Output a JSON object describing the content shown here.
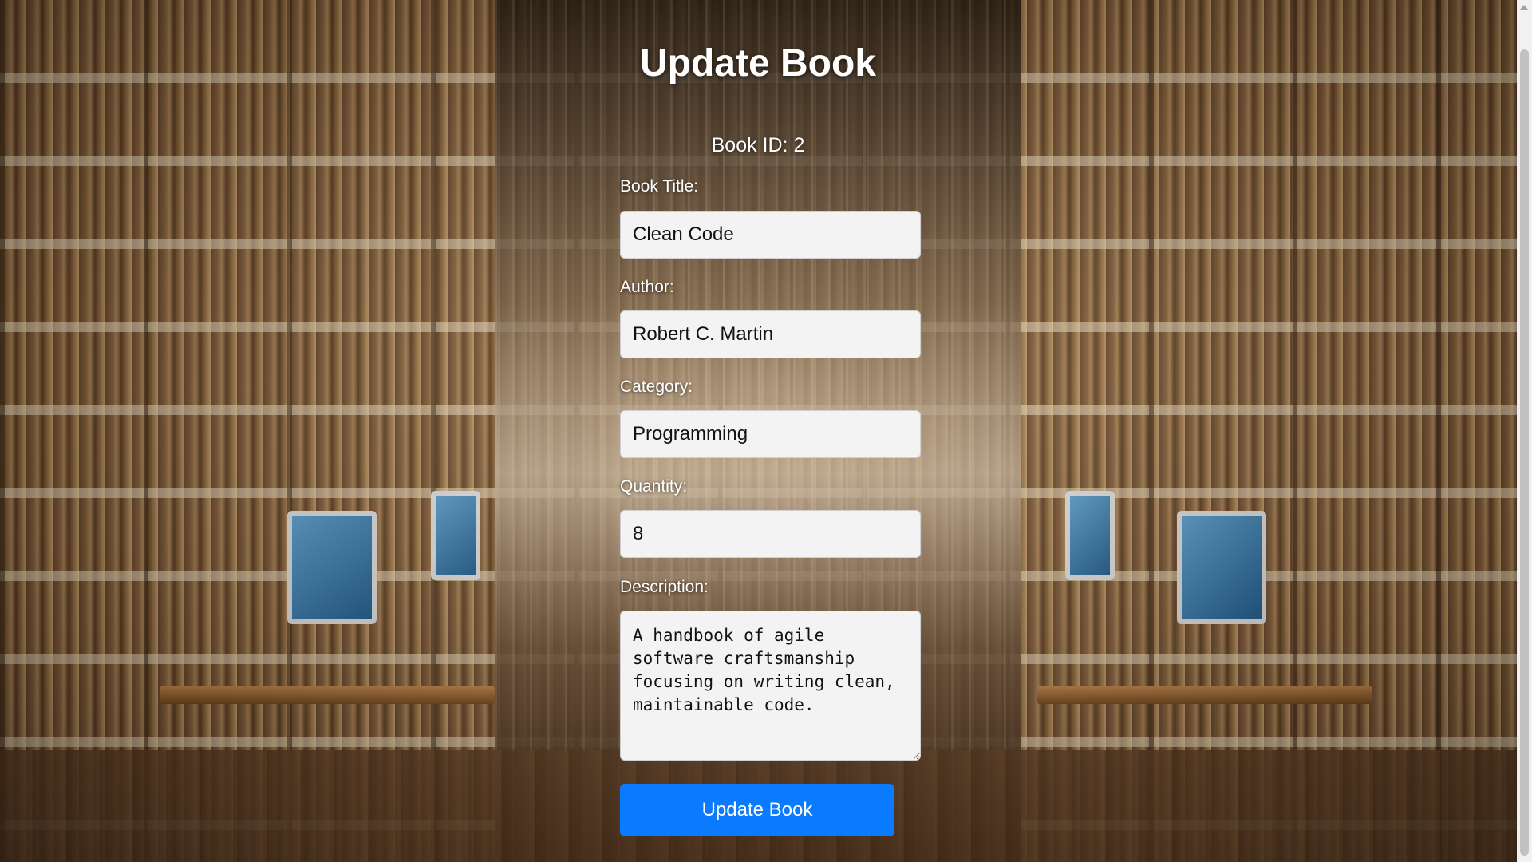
{
  "page": {
    "title": "Update Book",
    "book_id": "Book ID: 2"
  },
  "form": {
    "title_label": "Book Title:",
    "title_value": "Clean Code",
    "author_label": "Author:",
    "author_value": "Robert C. Martin",
    "category_label": "Category:",
    "category_value": "Programming",
    "quantity_label": "Quantity:",
    "quantity_value": "8",
    "description_label": "Description:",
    "description_value": "A handbook of agile software craftsmanship focusing on writing clean, maintainable code.",
    "submit_label": "Update Book"
  },
  "colors": {
    "button": "#0a7bff",
    "input_bg": "#f3f3f3",
    "text_light": "#ffffff"
  },
  "icons": {
    "scroll_up": "chevron-up-icon"
  }
}
